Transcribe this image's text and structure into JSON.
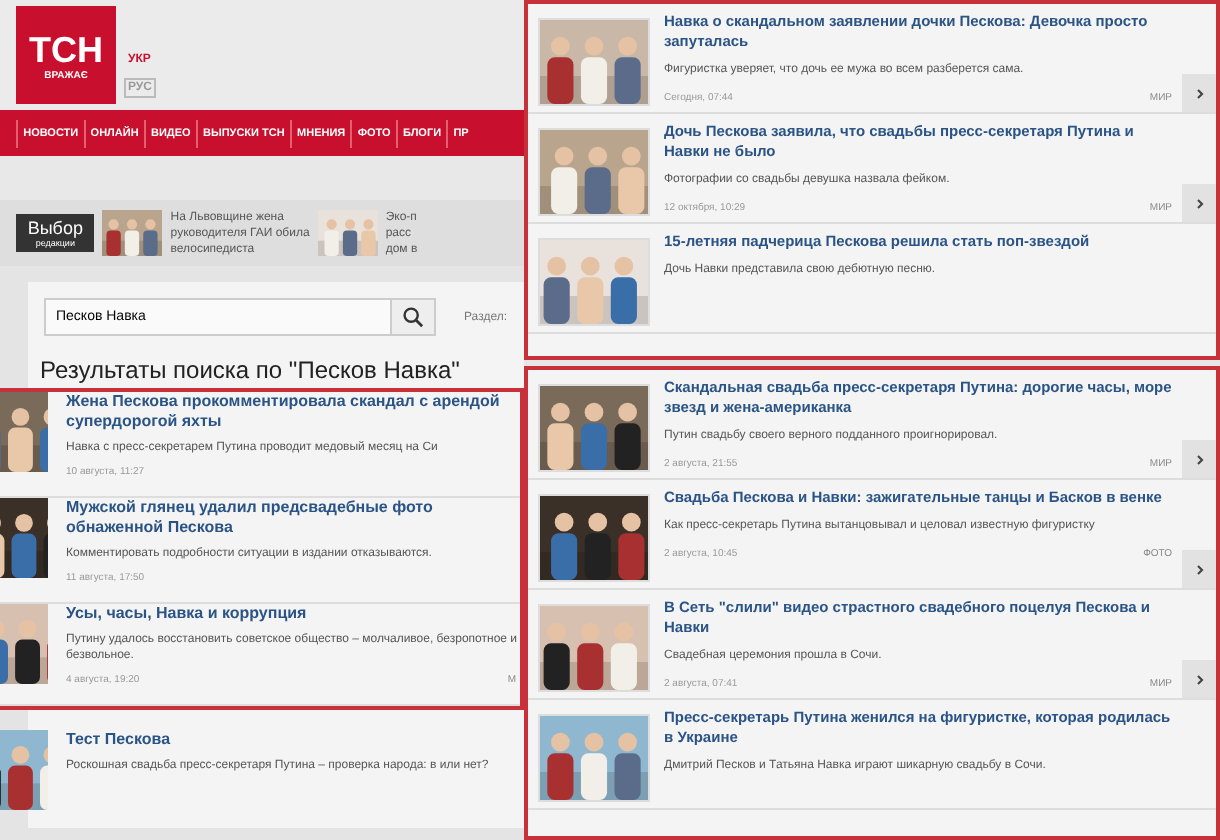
{
  "header": {
    "logo": "ТСН",
    "logo_tagline": "ВРАЖАЄ",
    "languages": [
      {
        "label": "УКР",
        "selected": true
      },
      {
        "label": "РУС",
        "selected": false
      }
    ]
  },
  "nav": [
    "НОВОСТИ",
    "ОНЛАЙН",
    "ВИДЕО",
    "ВЫПУСКИ ТСН",
    "МНЕНИЯ",
    "ФОТО",
    "БЛОГИ",
    "ПР"
  ],
  "editors_choice": {
    "label": "Выбор",
    "sublabel": "редакции",
    "items": [
      {
        "lines": [
          "На Львовщине жена",
          "руководителя ГАИ обила",
          "велосипедиста"
        ]
      },
      {
        "lines": [
          "Эко-п",
          "расс",
          "дом в"
        ]
      }
    ]
  },
  "search": {
    "value": "Песков Навка",
    "section_label": "Раздел:"
  },
  "results_title": "Результаты поиска по \"Песков Навка\"",
  "results": [
    {
      "title": "Жена Пескова прокомментировала скандал с арендой супердорогой яхты",
      "summary": "Навка с пресс-секретарем Путина проводит медовый месяц на Си",
      "date": "10 августа, 11:27"
    },
    {
      "title": "Мужской глянец удалил предсвадебные фото обнаженной Пескова",
      "summary": "Комментировать подробности ситуации в издании отказываются.",
      "date": "11 августа, 17:50"
    },
    {
      "title": "Усы, часы, Навка и коррупция",
      "summary": "Путину удалось восстановить советское общество – молчаливое, безропотное и безвольное.",
      "date": "4 августа, 19:20",
      "category": "М"
    }
  ],
  "more_results": [
    {
      "title": "Тест Пескова",
      "summary": "Роскошная свадьба пресс-секретаря Путина – проверка народа: в или нет?"
    }
  ],
  "panels": [
    {
      "items": [
        {
          "title": "Навка о скандальном заявлении дочки Пескова: Девочка просто запуталась",
          "summary": "Фигуристка уверяет, что дочь ее мужа во всем разберется сама.",
          "date": "Сегодня, 07:44",
          "category": "МИР"
        },
        {
          "title": "Дочь Пескова заявила, что свадьбы пресс-секретаря Путина и Навки не было",
          "summary": "Фотографии со свадьбы девушка назвала фейком.",
          "date": "12 октября, 10:29",
          "category": "МИР"
        },
        {
          "title": "15-летняя падчерица Пескова решила стать поп-звездой",
          "summary": "Дочь Навки представила свою дебютную песню."
        }
      ]
    },
    {
      "items": [
        {
          "title": "Скандальная свадьба пресс-секретаря Путина: дорогие часы, море звезд и жена-американка",
          "summary": "Путин свадьбу своего верного подданного проигнорировал.",
          "date": "2 августа, 21:55",
          "category": "МИР"
        },
        {
          "title": "Свадьба Пескова и Навки: зажигательные танцы и Басков в венке",
          "summary": "Как пресс-секретарь Путина вытанцовывал и целовал известную фигуристку",
          "date": "2 августа, 10:45",
          "category": "ФОТО"
        },
        {
          "title": "В Сеть \"слили\" видео страстного свадебного поцелуя Пескова и Навки",
          "summary": "Свадебная церемония прошла в Сочи.",
          "date": "2 августа, 07:41",
          "category": "МИР"
        },
        {
          "title": "Пресс-секретарь Путина женился на фигуристке, которая родилась в Украине",
          "summary": "Дмитрий Песков и Татьяна Навка играют шикарную свадьбу в Сочи."
        }
      ]
    }
  ]
}
